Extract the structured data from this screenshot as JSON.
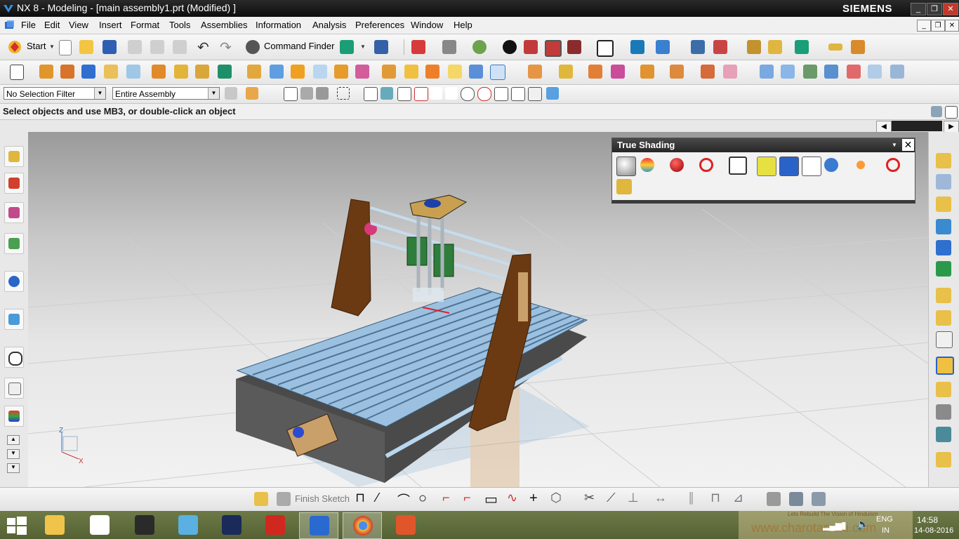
{
  "window": {
    "title": "NX 8 - Modeling - [main assembly1.prt (Modified) ]",
    "brand": "SIEMENS",
    "controls": {
      "minimize": "_",
      "maximize": "❐",
      "close": "✕"
    }
  },
  "menubar": {
    "items": [
      "File",
      "Edit",
      "View",
      "Insert",
      "Format",
      "Tools",
      "Assemblies",
      "Information",
      "Analysis",
      "Preferences",
      "Window",
      "Help"
    ],
    "doc_controls": {
      "minimize": "_",
      "restore": "❐",
      "close": "✕"
    }
  },
  "standard_toolbar": {
    "start_label": "Start",
    "command_finder_label": "Command Finder"
  },
  "selection_bar": {
    "filter_value": "No Selection Filter",
    "scope_value": "Entire Assembly"
  },
  "cue_line": {
    "text": "Select objects and use MB3, or double-click an object"
  },
  "true_shading": {
    "title": "True Shading",
    "close": "✕"
  },
  "view_triad": {
    "z": "Z",
    "x": "X"
  },
  "sketch_toolbar": {
    "finish_sketch_label": "Finish Sketch"
  },
  "taskbar": {
    "language": "ENG",
    "region": "IN",
    "time": "14:58",
    "date": "14-08-2016",
    "watermark": "www.charotarwiki.com",
    "watermark_tag": "Lets Rebuild The Vision of Hinduism"
  },
  "colors": {
    "accent_blue": "#1c5fb8",
    "machine_frame": "#6b3a12",
    "rail": "#8fb6d8",
    "taskbar": "#5f6b3c"
  }
}
